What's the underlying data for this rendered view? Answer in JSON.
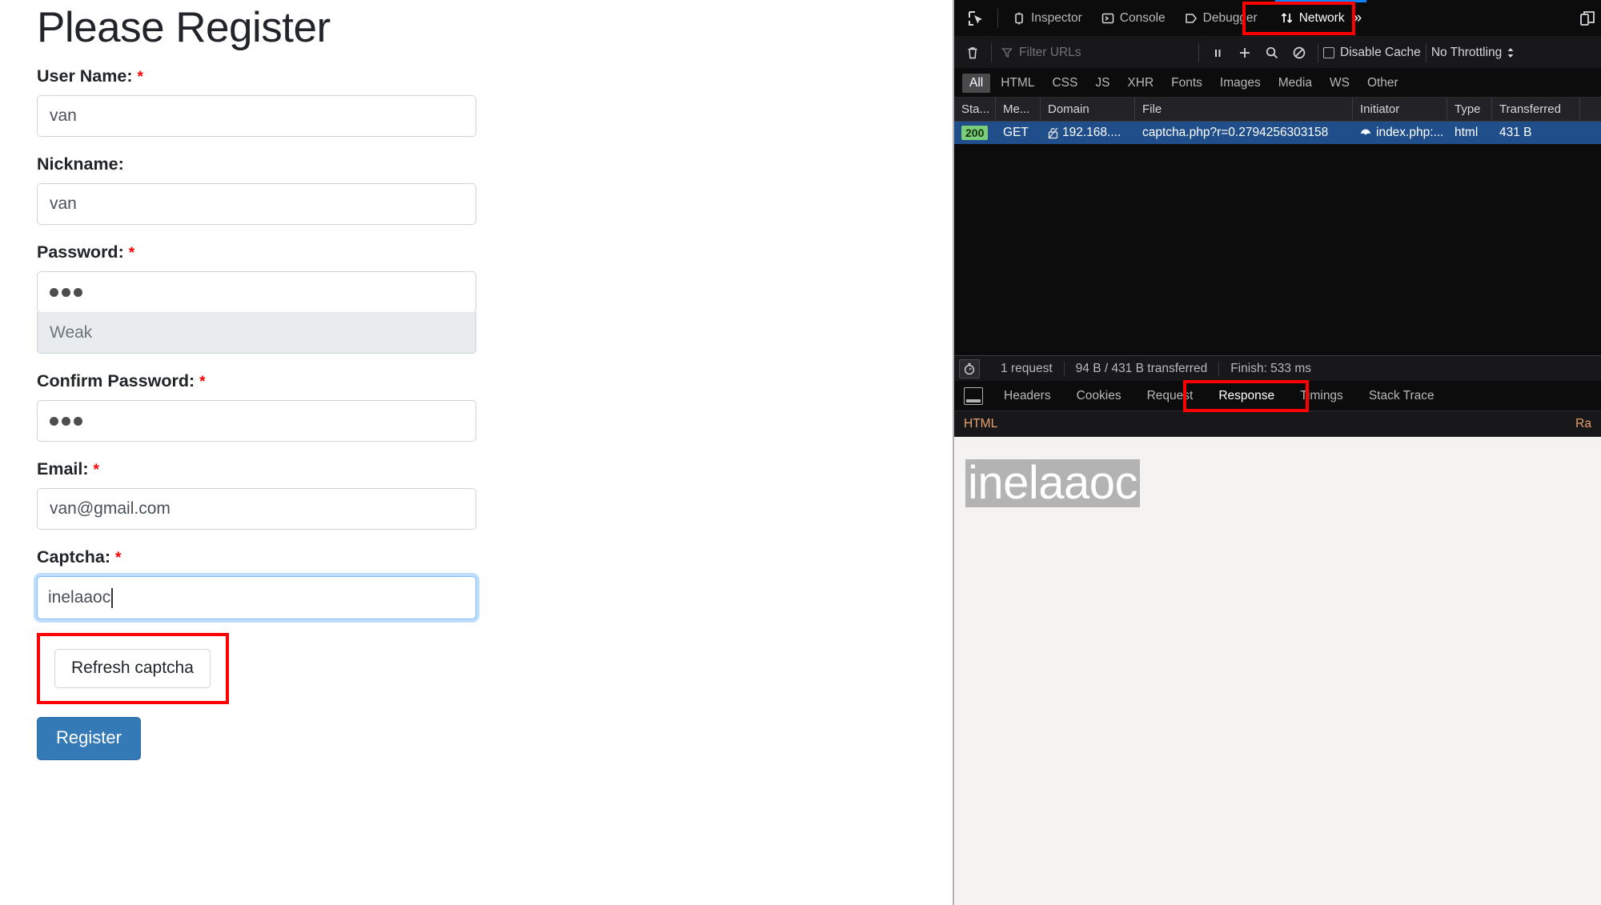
{
  "webpage": {
    "title": "Please Register",
    "fields": [
      {
        "label": "User Name:",
        "required": true,
        "value": "van",
        "type": "text"
      },
      {
        "label": "Nickname:",
        "required": false,
        "value": "van",
        "type": "text"
      },
      {
        "label": "Password:",
        "required": true,
        "value": "•••",
        "masked_count": 3,
        "type": "password",
        "strength": "Weak"
      },
      {
        "label": "Confirm Password:",
        "required": true,
        "value": "•••",
        "masked_count": 3,
        "type": "password"
      },
      {
        "label": "Email:",
        "required": true,
        "value": "van@gmail.com",
        "type": "email"
      },
      {
        "label": "Captcha:",
        "required": true,
        "value": "inelaaoc",
        "type": "text",
        "focused": true
      }
    ],
    "refresh_button": "Refresh captcha",
    "submit_button": "Register",
    "required_marker": "*",
    "accent_color": "#337ab7",
    "highlight_color": "#ff0000"
  },
  "devtools": {
    "toolbox_tabs": [
      {
        "label": "Inspector",
        "icon": "inspector-icon",
        "selected": false
      },
      {
        "label": "Console",
        "icon": "console-icon",
        "selected": false
      },
      {
        "label": "Debugger",
        "icon": "debugger-icon",
        "selected": false
      },
      {
        "label": "Network",
        "icon": "network-icon",
        "selected": true
      }
    ],
    "overflow_chevron": "»",
    "responsive_mode_icon": "responsive-design-mode-icon",
    "network_toolbar": {
      "clear_icon": "trash-icon",
      "filter_placeholder": "Filter URLs",
      "pause_icon": "pause-icon",
      "plus_icon": "plus-icon",
      "search_icon": "search-icon",
      "block_icon": "block-icon",
      "disable_cache_label": "Disable Cache",
      "disable_cache_checked": false,
      "throttling_value": "No Throttling"
    },
    "type_filters": [
      {
        "label": "All",
        "active": true
      },
      {
        "label": "HTML",
        "active": false
      },
      {
        "label": "CSS",
        "active": false
      },
      {
        "label": "JS",
        "active": false
      },
      {
        "label": "XHR",
        "active": false
      },
      {
        "label": "Fonts",
        "active": false
      },
      {
        "label": "Images",
        "active": false
      },
      {
        "label": "Media",
        "active": false
      },
      {
        "label": "WS",
        "active": false
      },
      {
        "label": "Other",
        "active": false
      }
    ],
    "request_columns": [
      "Sta...",
      "Me...",
      "Domain",
      "File",
      "Initiator",
      "Type",
      "Transferred"
    ],
    "requests": [
      {
        "status": "200",
        "method": "GET",
        "domain": "192.168....",
        "file": "captcha.php?r=0.2794256303158",
        "initiator": "index.php:...",
        "type": "html",
        "transferred": "431 B",
        "selected": true,
        "security_icon": "broken-lock-icon",
        "initiator_icon": "cause-icon"
      }
    ],
    "summary": {
      "timer_icon": "stopwatch-icon",
      "request_count": "1 request",
      "transferred": "94 B / 431 B transferred",
      "finish": "Finish: 533 ms"
    },
    "detail_tabs": [
      {
        "label": "Headers",
        "active": false
      },
      {
        "label": "Cookies",
        "active": false
      },
      {
        "label": "Request",
        "active": false
      },
      {
        "label": "Response",
        "active": true
      },
      {
        "label": "Timings",
        "active": false
      },
      {
        "label": "Stack Trace",
        "active": false
      }
    ],
    "response_panel": {
      "section_label": "HTML",
      "raw_label": "Ra",
      "rendered_text": "inelaaoc"
    }
  }
}
